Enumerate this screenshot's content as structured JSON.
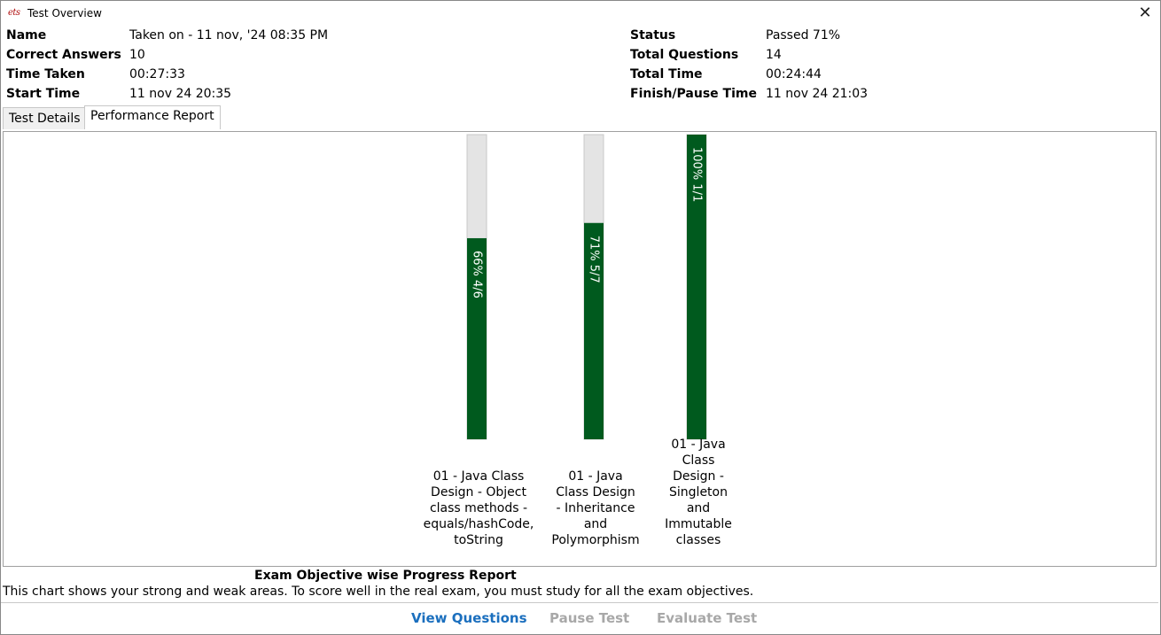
{
  "window": {
    "title": "Test Overview",
    "app_icon_text": "ets"
  },
  "summary": {
    "left": [
      {
        "label": "Name",
        "value": "Taken on - 11 nov, '24 08:35 PM"
      },
      {
        "label": "Correct Answers",
        "value": "10"
      },
      {
        "label": "Time Taken",
        "value": "00:27:33"
      },
      {
        "label": "Start Time",
        "value": "11 nov 24 20:35"
      }
    ],
    "right": [
      {
        "label": "Status",
        "value": "Passed 71%"
      },
      {
        "label": "Total Questions",
        "value": "14"
      },
      {
        "label": "Total Time",
        "value": "00:24:44"
      },
      {
        "label": "Finish/Pause Time",
        "value": "11 nov 24 21:03"
      }
    ]
  },
  "tabs": [
    {
      "label": "Test Details",
      "active": false
    },
    {
      "label": "Performance Report",
      "active": true
    }
  ],
  "chart_data": {
    "type": "bar",
    "orientation": "vertical-stacked-progress",
    "categories": [
      [
        "01 - Java Class",
        "Design - Object",
        "class methods -",
        "equals/hashCode,",
        "toString"
      ],
      [
        "01 - Java",
        "Class Design",
        "- Inheritance",
        "and",
        "Polymorphism"
      ],
      [
        "01 - Java",
        "Class",
        "Design -",
        "Singleton",
        "and",
        "Immutable",
        "classes"
      ]
    ],
    "values": [
      0.66,
      0.71,
      1.0
    ],
    "bar_labels": [
      "66% 4/6",
      "71% 5/7",
      "100% 1/1"
    ],
    "ylim": [
      0,
      1
    ],
    "colors": {
      "filled": "#005a1e",
      "empty": "#e4e4e4"
    },
    "title": "Exam Objective wise Progress Report",
    "description": "This chart shows your strong and weak areas. To score well in the real exam, you must study for all the exam objectives."
  },
  "buttons": {
    "view_questions": "View Questions",
    "pause_test": "Pause Test",
    "evaluate_test": "Evaluate Test"
  }
}
